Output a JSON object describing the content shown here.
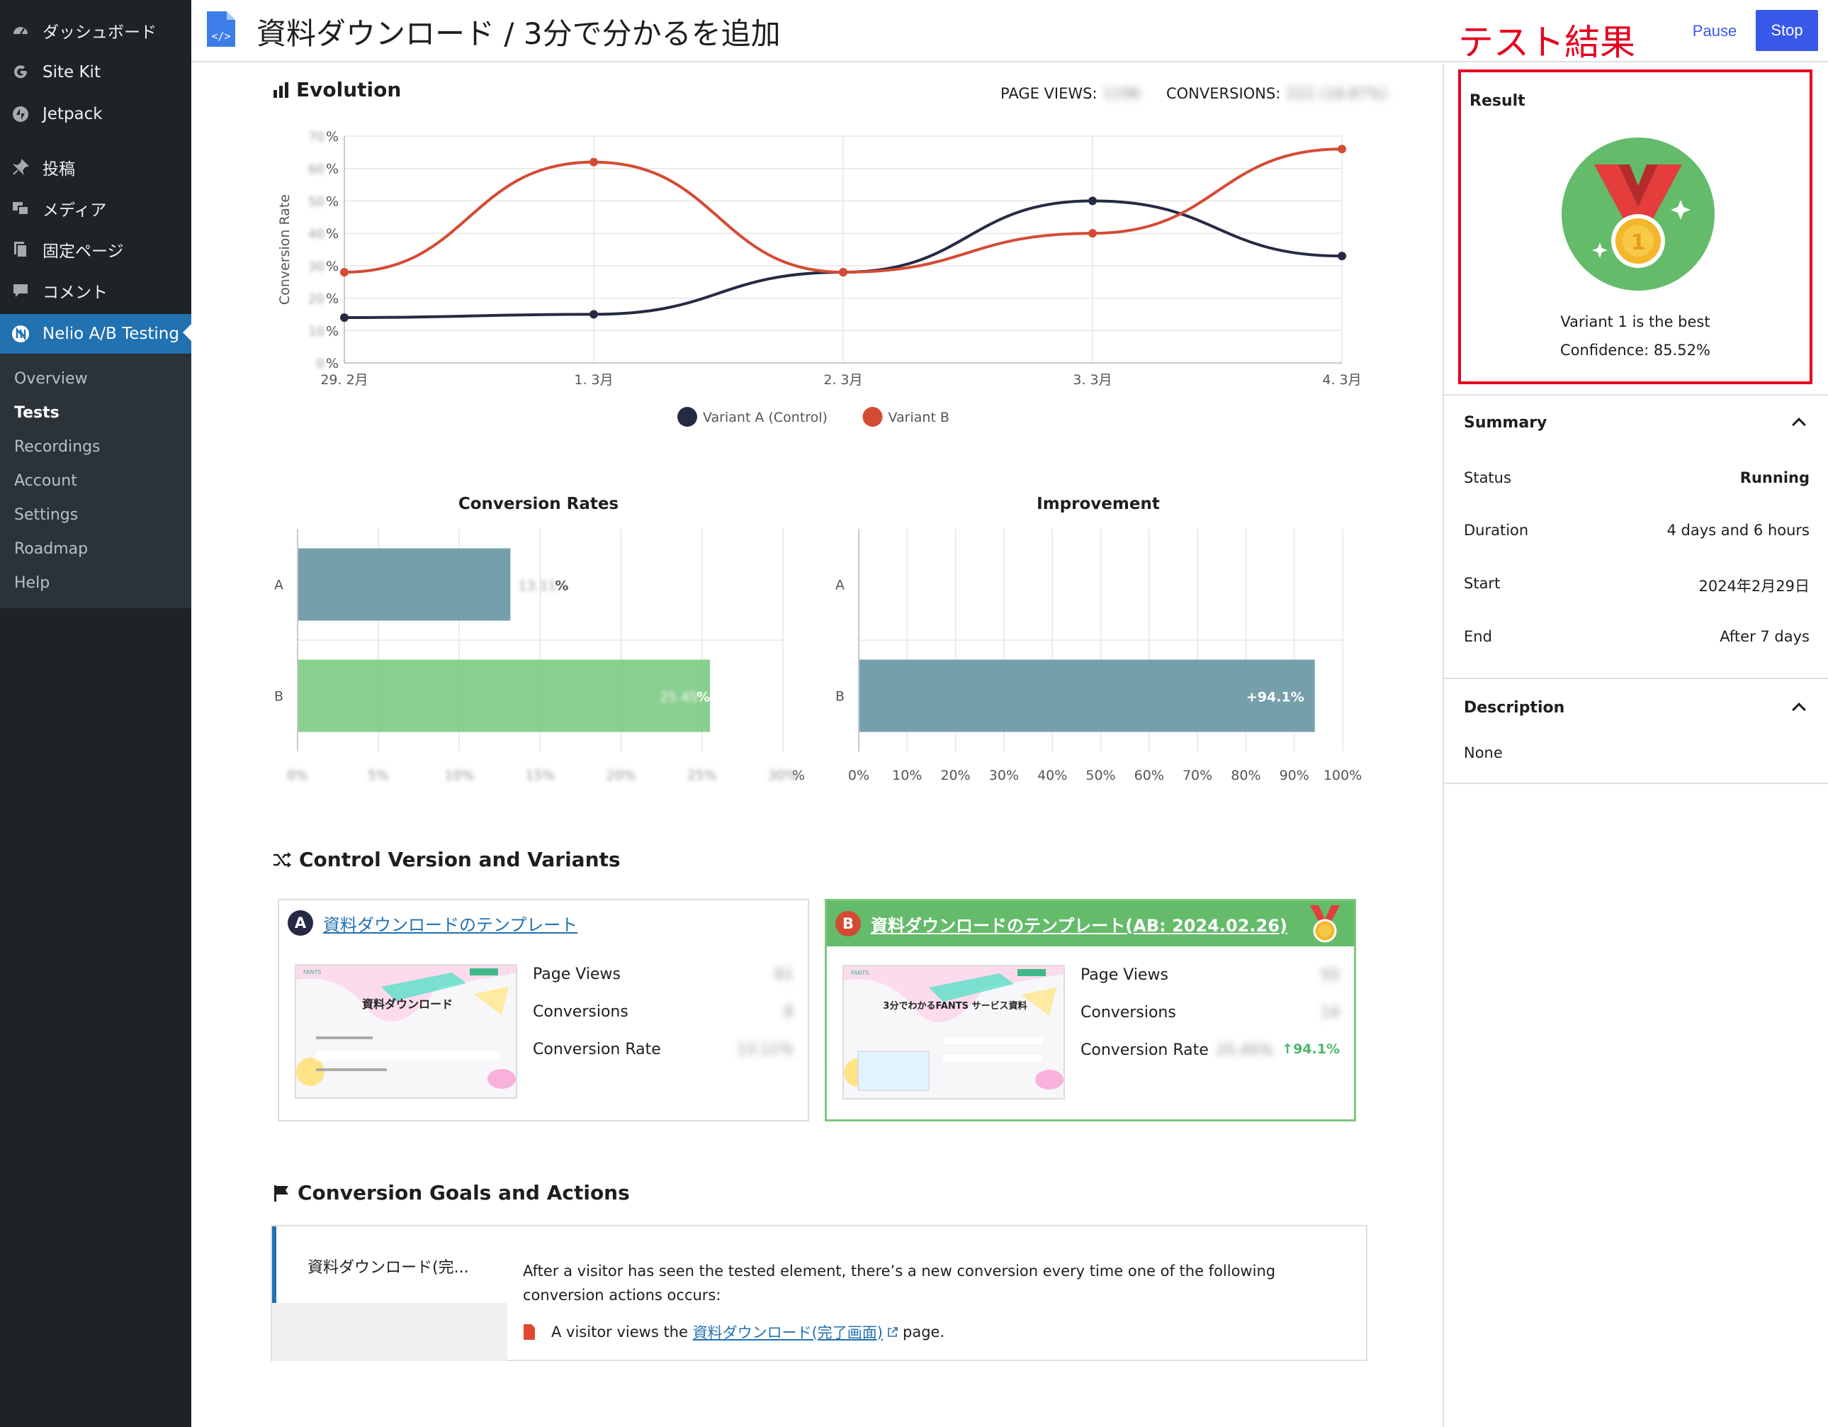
{
  "sidebar": {
    "items": [
      {
        "label": "ダッシュボード",
        "icon": "dashboard-icon"
      },
      {
        "label": "Site Kit",
        "icon": "google-g-icon"
      },
      {
        "label": "Jetpack",
        "icon": "jetpack-icon"
      },
      {
        "label": "投稿",
        "icon": "pin-icon"
      },
      {
        "label": "メディア",
        "icon": "media-icon"
      },
      {
        "label": "固定ページ",
        "icon": "pages-icon"
      },
      {
        "label": "コメント",
        "icon": "comment-icon"
      },
      {
        "label": "Nelio A/B Testing",
        "icon": "nelio-icon"
      }
    ],
    "submenu": [
      "Overview",
      "Tests",
      "Recordings",
      "Account",
      "Settings",
      "Roadmap",
      "Help"
    ],
    "current_submenu": "Tests"
  },
  "header": {
    "title": "資料ダウンロード / 3分で分かるを追加",
    "annotation": "テスト結果",
    "pause_label": "Pause",
    "stop_label": "Stop"
  },
  "evolution": {
    "title": "Evolution",
    "page_views_label": "PAGE VIEWS:",
    "page_views_value": "1196",
    "conversions_label": "CONVERSIONS:",
    "conversions_value": "222 (18.87%)"
  },
  "chart_data": [
    {
      "type": "line",
      "title": "Evolution",
      "ylabel": "Conversion Rate",
      "x": [
        "29. 2月",
        "1. 3月",
        "2. 3月",
        "3. 3月",
        "4. 3月"
      ],
      "y_tick_suffix": "%",
      "series": [
        {
          "name": "Variant A (Control)",
          "color": "#262a44",
          "values": [
            14,
            15,
            28,
            50,
            33
          ]
        },
        {
          "name": "Variant B",
          "color": "#d44b33",
          "values": [
            28,
            62,
            28,
            40,
            66
          ]
        }
      ],
      "ylim": [
        0,
        70
      ],
      "grid": true,
      "legend": "bottom"
    },
    {
      "type": "bar",
      "orientation": "horizontal",
      "title": "Conversion Rates",
      "categories": [
        "A",
        "B"
      ],
      "values": [
        13.11,
        25.45
      ],
      "colors": [
        "#6f9aa8",
        "#83cc88"
      ],
      "xlim": [
        0,
        30
      ],
      "tick_suffix": "%"
    },
    {
      "type": "bar",
      "orientation": "horizontal",
      "title": "Improvement",
      "categories": [
        "A",
        "B"
      ],
      "values": [
        0,
        94.1
      ],
      "bar_labels": [
        "",
        "+94.1%"
      ],
      "colors": [
        "#6f9aa8",
        "#6f9aa8"
      ],
      "xlim": [
        0,
        100
      ],
      "xticks": [
        "0%",
        "10%",
        "20%",
        "30%",
        "40%",
        "50%",
        "60%",
        "70%",
        "80%",
        "90%",
        "100%"
      ]
    }
  ],
  "variants_section": {
    "title": "Control Version and Variants",
    "stat_labels": [
      "Page Views",
      "Conversions",
      "Conversion Rate"
    ],
    "variants": [
      {
        "letter": "A",
        "name": "資料ダウンロードのテンプレート",
        "thumb_heading": "資料ダウンロード",
        "page_views": "61",
        "conversions": "8",
        "conversion_rate": "13.11%",
        "improvement": "",
        "badge_color": "#262a44"
      },
      {
        "letter": "B",
        "name": "資料ダウンロードのテンプレート(AB: 2024.02.26)",
        "thumb_heading": "3分でわかるFANTS サービス資料",
        "page_views": "55",
        "conversions": "14",
        "conversion_rate": "25.45%",
        "improvement": "↑94.1%",
        "badge_color": "#d44b33"
      }
    ],
    "thumb_brand": "FANTS"
  },
  "goals_section": {
    "title": "Conversion Goals and Actions",
    "goal_name": "資料ダウンロード(完...",
    "description": "After a visitor has seen the tested element, there’s a new conversion every time one of the following conversion actions occurs:",
    "action_prefix": "A visitor views the",
    "action_link": "資料ダウンロード(完了画面)",
    "action_suffix": "page."
  },
  "result": {
    "title": "Result",
    "winner_text": "Variant 1 is the best",
    "confidence_text": "Confidence: 85.52%"
  },
  "summary": {
    "title": "Summary",
    "rows": [
      {
        "label": "Status",
        "value": "Running"
      },
      {
        "label": "Duration",
        "value": "4 days and 6 hours"
      },
      {
        "label": "Start",
        "value": "2024年2月29日"
      },
      {
        "label": "End",
        "value": "After 7 days"
      }
    ]
  },
  "description": {
    "title": "Description",
    "value": "None"
  }
}
